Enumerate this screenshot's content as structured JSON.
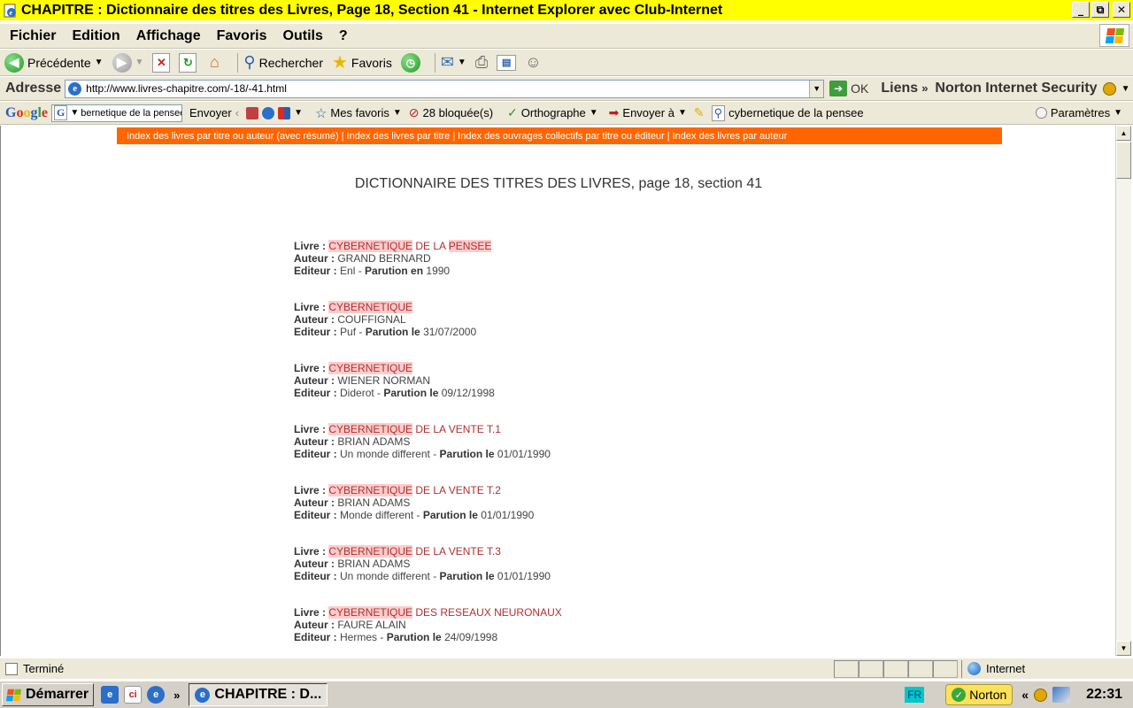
{
  "window": {
    "title": "CHAPITRE : Dictionnaire des titres des Livres, Page 18, Section 41 - Internet Explorer avec Club-Internet",
    "minimize": "_",
    "maximize": "⧉",
    "close": "✕"
  },
  "menu": [
    "Fichier",
    "Edition",
    "Affichage",
    "Favoris",
    "Outils",
    "?"
  ],
  "toolbar": {
    "back": "Précédente",
    "search": "Rechercher",
    "favorites": "Favoris"
  },
  "address": {
    "label": "Adresse",
    "url": "http://www.livres-chapitre.com/-18/-41.html",
    "go": "OK",
    "links": "Liens",
    "norton": "Norton Internet Security"
  },
  "google_bar": {
    "logo": "Google",
    "query": "bernetique de la pensee\"",
    "send": "Envoyer",
    "my_favorites": "Mes favoris",
    "blocked": "28 bloquée(s)",
    "spelling": "Orthographe",
    "send_to": "Envoyer à",
    "search_term": "cybernetique de la pensee",
    "settings": "Paramètres"
  },
  "nav_band": [
    "Index des livres par titre ou auteur (avec résumé)",
    "Index des livres par titre",
    "Index des ouvrages collectifs par titre ou éditeur",
    "Index des livres par auteur"
  ],
  "page": {
    "heading": "DICTIONNAIRE DES TITRES DES LIVRES, page 18, section 41",
    "labels": {
      "book": "Livre :",
      "author": "Auteur :",
      "publisher": "Editeur :",
      "published_on": "Parution le",
      "published_in": "Parution en"
    }
  },
  "books": [
    {
      "hl1": "CYBERNETIQUE",
      "mid": " DE LA ",
      "hl2": "PENSEE",
      "rest": "",
      "author": "GRAND BERNARD",
      "publisher": "Enl",
      "date_label": "Parution en",
      "date": "1990"
    },
    {
      "hl1": "CYBERNETIQUE",
      "mid": "",
      "hl2": "",
      "rest": "",
      "author": "COUFFIGNAL",
      "publisher": "Puf",
      "date_label": "Parution le",
      "date": "31/07/2000"
    },
    {
      "hl1": "CYBERNETIQUE",
      "mid": "",
      "hl2": "",
      "rest": "",
      "author": "WIENER NORMAN",
      "publisher": "Diderot",
      "date_label": "Parution le",
      "date": "09/12/1998"
    },
    {
      "hl1": "CYBERNETIQUE",
      "mid": "",
      "hl2": "",
      "rest": " DE LA VENTE T.1",
      "author": "BRIAN ADAMS",
      "publisher": "Un monde different",
      "date_label": "Parution le",
      "date": "01/01/1990"
    },
    {
      "hl1": "CYBERNETIQUE",
      "mid": "",
      "hl2": "",
      "rest": " DE LA VENTE T.2",
      "author": "BRIAN ADAMS",
      "publisher": "Monde different",
      "date_label": "Parution le",
      "date": "01/01/1990"
    },
    {
      "hl1": "CYBERNETIQUE",
      "mid": "",
      "hl2": "",
      "rest": " DE LA VENTE T.3",
      "author": "BRIAN ADAMS",
      "publisher": "Un monde different",
      "date_label": "Parution le",
      "date": "01/01/1990"
    },
    {
      "hl1": "CYBERNETIQUE",
      "mid": "",
      "hl2": "",
      "rest": " DES RESEAUX NEURONAUX",
      "author": "FAURE ALAIN",
      "publisher": "Hermes",
      "date_label": "Parution le",
      "date": "24/09/1998"
    }
  ],
  "status": {
    "text": "Terminé",
    "zone": "Internet"
  },
  "taskbar": {
    "start": "Démarrer",
    "task": "CHAPITRE : D...",
    "lang": "FR",
    "norton": "Norton",
    "clock": "22:31",
    "chevron": "»",
    "tray_chevron": "«"
  },
  "colors": {
    "title_bar": "#ffff00",
    "nav_band": "#ff6600",
    "highlight_bg": "#ffcccc",
    "highlight_text": "#b03030"
  }
}
